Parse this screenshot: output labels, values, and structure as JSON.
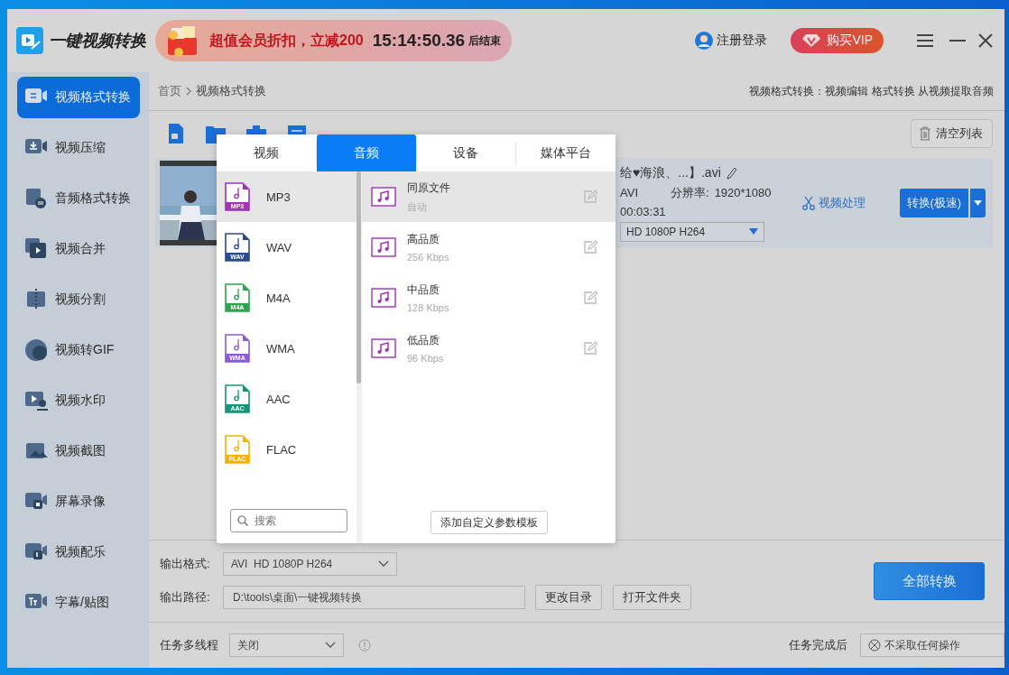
{
  "app": {
    "title": "一键视频转换"
  },
  "promo": {
    "text": "超值会员折扣，立减200",
    "countdown": "15:14:50.36",
    "suffix": "后结束"
  },
  "header": {
    "login": "注册登录",
    "vip": "购买VIP"
  },
  "sidebar": {
    "items": [
      {
        "label": "视频格式转换",
        "selected": true
      },
      {
        "label": "视频压缩",
        "selected": false
      },
      {
        "label": "音频格式转换",
        "selected": false
      },
      {
        "label": "视频合并",
        "selected": false
      },
      {
        "label": "视频分割",
        "selected": false
      },
      {
        "label": "视频转GIF",
        "selected": false
      },
      {
        "label": "视频水印",
        "selected": false
      },
      {
        "label": "视频截图",
        "selected": false
      },
      {
        "label": "屏幕录像",
        "selected": false
      },
      {
        "label": "视频配乐",
        "selected": false
      },
      {
        "label": "字幕/贴图",
        "selected": false
      }
    ]
  },
  "breadcrumb": {
    "home": "首页",
    "current": "视频格式转换"
  },
  "hint": "视频格式转换：视频编辑 格式转换 从视频提取音频",
  "toolbar": {
    "clear": "清空列表"
  },
  "file": {
    "name": "给♥海浪、...】.avi",
    "format": "AVI",
    "resolution_label": "分辨率:",
    "resolution": "1920*1080",
    "duration": "00:03:31",
    "preset": "HD 1080P H264",
    "edit": "视频处理",
    "convert": "转换(极速)"
  },
  "format_popup": {
    "tabs": [
      {
        "label": "视频",
        "selected": false
      },
      {
        "label": "音频",
        "selected": true
      },
      {
        "label": "设备",
        "selected": false
      },
      {
        "label": "媒体平台",
        "selected": false
      }
    ],
    "formats": [
      {
        "label": "MP3",
        "badge": "MP3",
        "color": "#a033b8",
        "selected": true
      },
      {
        "label": "WAV",
        "badge": "WAV",
        "color": "#2b4c8c",
        "selected": false
      },
      {
        "label": "M4A",
        "badge": "M4A",
        "color": "#2ea44f",
        "selected": false
      },
      {
        "label": "WMA",
        "badge": "WMA",
        "color": "#8a5cd6",
        "selected": false
      },
      {
        "label": "AAC",
        "badge": "AAC",
        "color": "#14967a",
        "selected": false
      },
      {
        "label": "FLAC",
        "badge": "FLAC",
        "color": "#f2b400",
        "selected": false
      }
    ],
    "search": {
      "placeholder": "搜索"
    },
    "presets": [
      {
        "name": "同原文件",
        "detail": "自动",
        "selected": true
      },
      {
        "name": "高品质",
        "detail": "256 Kbps",
        "selected": false
      },
      {
        "name": "中品质",
        "detail": "128 Kbps",
        "selected": false
      },
      {
        "name": "低品质",
        "detail": "96 Kbps",
        "selected": false
      }
    ],
    "add_template": "添加自定义参数模板"
  },
  "output": {
    "format_label": "输出格式:",
    "format": "AVI  HD 1080P H264",
    "path_label": "输出路径:",
    "path": "D:\\tools\\桌面\\一键视频转换",
    "change_dir": "更改目录",
    "open_folder": "打开文件夹",
    "convert_all": "全部转换"
  },
  "status_bar": {
    "threads_label": "任务多线程",
    "threads": "关闭",
    "after_label": "任务完成后",
    "after": "不采取任何操作"
  }
}
